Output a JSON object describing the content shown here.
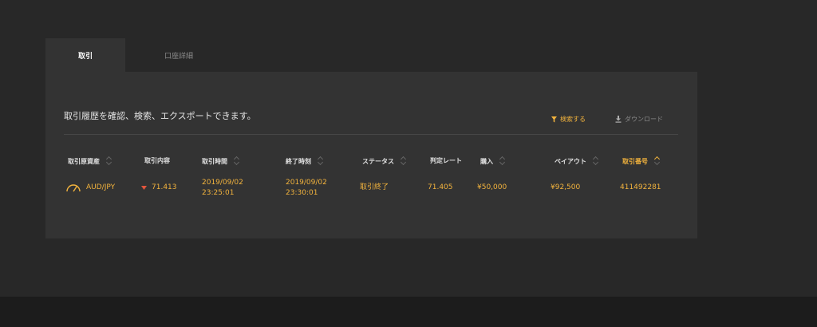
{
  "tabs": [
    {
      "label": "取引",
      "active": true
    },
    {
      "label": "口座詳細",
      "active": false
    }
  ],
  "description": "取引履歴を確認、検索、エクスポートできます。",
  "actions": {
    "search_label": "検索する",
    "download_label": "ダウンロード"
  },
  "columns": [
    "取引原資産",
    "取引内容",
    "取引時間",
    "終了時刻",
    "ステータス",
    "判定レート",
    "購入",
    "ペイアウト",
    "取引番号"
  ],
  "rows": [
    {
      "asset": "AUD/JPY",
      "direction": "down",
      "content_rate": "71.413",
      "trade_date": "2019/09/02",
      "trade_time": "23:25:01",
      "end_date": "2019/09/02",
      "end_time": "23:30:01",
      "status": "取引終了",
      "judge_rate": "71.405",
      "purchase": "¥50,000",
      "payout": "¥92,500",
      "trade_id": "411492281"
    }
  ],
  "colors": {
    "accent": "#f2b33d",
    "down": "#e2553d",
    "panel": "#333333",
    "background": "#282828"
  },
  "icons": {
    "asset": "gauge-icon",
    "search": "filter-icon",
    "download": "download-icon",
    "direction": "down-arrow-icon"
  }
}
